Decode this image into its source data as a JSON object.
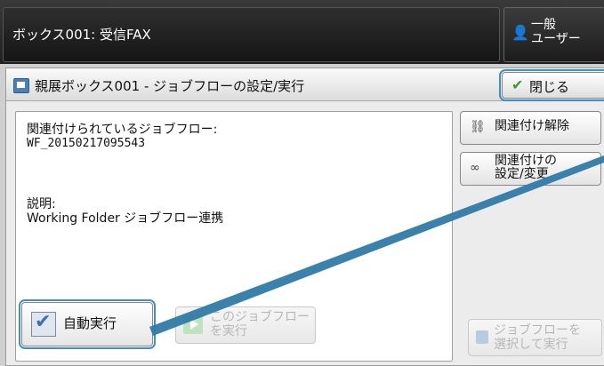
{
  "topbar": {
    "title": "ボックス001: 受信FAX",
    "user_line1": "一般",
    "user_line2": "ユーザー",
    "user_icon": "user-icon"
  },
  "dialog": {
    "title": "親展ボックス001 - ジョブフローの設定/実行",
    "close_label": "閉じる",
    "linked_flow_label": "関連付けられているジョブフロー:",
    "linked_flow_value": "WF_20150217095543",
    "description_label": "説明:",
    "description_value": "Working Folder ジョブフロー連携",
    "unlink_label": "関連付け解除",
    "link_settings_line1": "関連付けの",
    "link_settings_line2": "設定/変更",
    "auto_run_label": "自動実行",
    "auto_run_checked": true,
    "run_flow_line1": "このジョブフロー",
    "run_flow_line2": "を実行",
    "select_run_line1": "ジョブフローを",
    "select_run_line2": "選択して実行"
  },
  "colors": {
    "highlight": "#3f8fc4",
    "callout_line": "#2f7aa6"
  }
}
